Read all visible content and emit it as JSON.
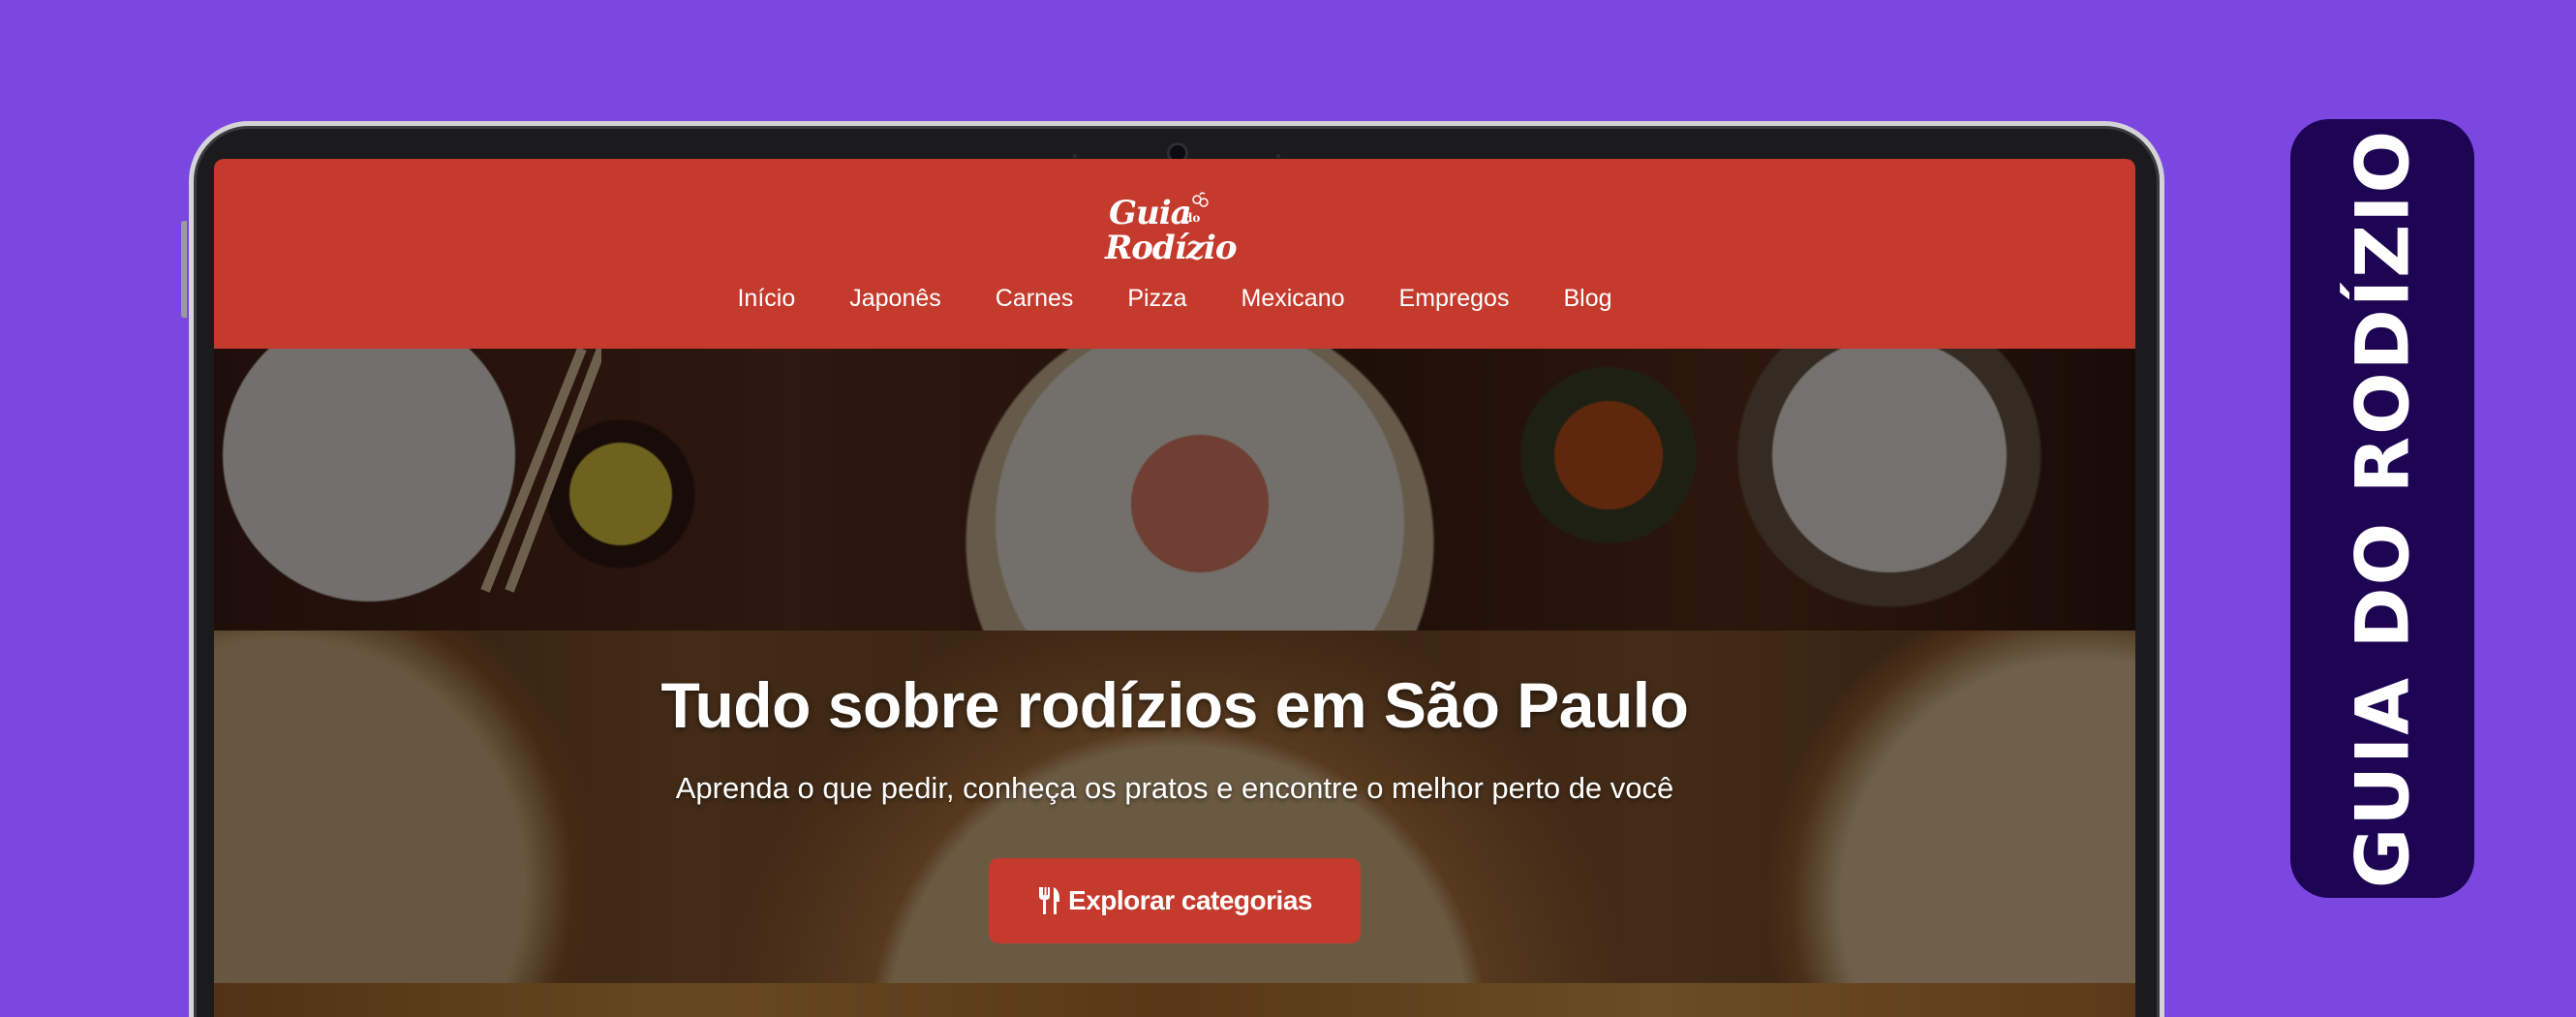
{
  "site": {
    "logo_line1": "Guia",
    "logo_do": "do",
    "logo_line2": "Rodízio",
    "nav": [
      "Início",
      "Japonês",
      "Carnes",
      "Pizza",
      "Mexicano",
      "Empregos",
      "Blog"
    ]
  },
  "hero": {
    "title": "Tudo sobre rodízios em São Paulo",
    "subtitle": "Aprenda o que pedir, conheça os pratos e encontre o melhor perto de você",
    "cta_label": "Explorar categorias",
    "cta_icon": "fork-knife-icon"
  },
  "brand_badge": {
    "text": "GUIA DO RODÍZIO"
  },
  "colors": {
    "background": "#7b47e0",
    "header_red": "#c43a2d",
    "badge_bg": "#1e0553"
  }
}
